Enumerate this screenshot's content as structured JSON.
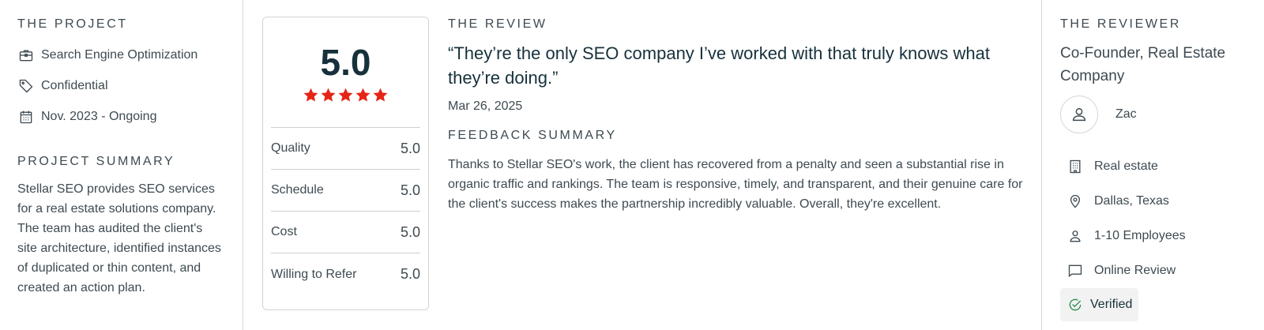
{
  "project": {
    "title": "THE PROJECT",
    "items": [
      {
        "icon": "briefcase-icon",
        "label": "Search Engine Optimization"
      },
      {
        "icon": "tag-icon",
        "label": "Confidential"
      },
      {
        "icon": "calendar-icon",
        "label": "Nov. 2023 - Ongoing"
      }
    ],
    "summary_title": "PROJECT SUMMARY",
    "summary_text": "Stellar SEO provides SEO services for a real estate solutions company. The team has audited the client's site architecture, identified instances of duplicated or thin content, and created an action plan."
  },
  "rating": {
    "overall": "5.0",
    "stars": 5,
    "star_color": "#e62415",
    "rows": [
      {
        "label": "Quality",
        "value": "5.0"
      },
      {
        "label": "Schedule",
        "value": "5.0"
      },
      {
        "label": "Cost",
        "value": "5.0"
      },
      {
        "label": "Willing to Refer",
        "value": "5.0"
      }
    ]
  },
  "review": {
    "title": "THE REVIEW",
    "quote": "“They’re the only SEO company I’ve worked with that truly knows what they’re doing.”",
    "date": "Mar 26, 2025",
    "feedback_title": "FEEDBACK SUMMARY",
    "feedback_text": "Thanks to Stellar SEO's work, the client has recovered from a penalty and seen a substantial rise in organic traffic and rankings. The team is responsive, timely, and transparent, and their genuine care for the client's success makes the partnership incredibly valuable. Overall, they're excellent."
  },
  "reviewer": {
    "title": "THE REVIEWER",
    "role": "Co-Founder, Real Estate Company",
    "name": "Zac",
    "avatar_icon": "user-icon",
    "details": [
      {
        "icon": "building-icon",
        "label": "Real estate"
      },
      {
        "icon": "location-pin-icon",
        "label": "Dallas, Texas"
      },
      {
        "icon": "person-icon",
        "label": "1-10 Employees"
      },
      {
        "icon": "chat-bubble-icon",
        "label": "Online Review"
      }
    ],
    "verified_label": "Verified",
    "verified_icon": "check-circle-icon",
    "verified_color": "#2f8f52"
  }
}
